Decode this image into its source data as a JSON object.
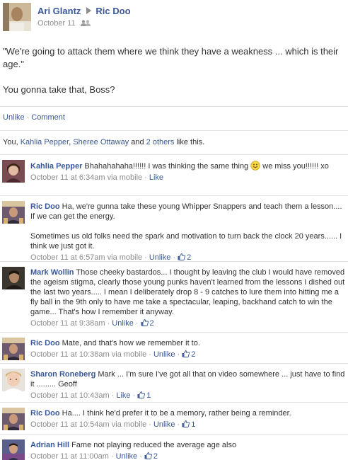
{
  "post": {
    "author": "Ari Glantz",
    "target": "Ric Doo",
    "date": "October 11",
    "text_line1": "\"We're going to attack them where we think they have a weakness ... which is their age.\"",
    "text_line2": "You gonna take that, Boss?",
    "action_unlike": "Unlike",
    "action_comment": "Comment",
    "likes_prefix": "You, ",
    "liker1": "Kahlia Pepper",
    "likes_sep": ", ",
    "liker2": "Sheree Ottaway",
    "likes_and": " and ",
    "likes_others": "2 others",
    "likes_suffix": " like this."
  },
  "comments": [
    {
      "author": "Kahlia Pepper",
      "text": " Bhahahahaha!!!!!! I was thinking the same thing ",
      "text_after_emoji": " we miss you!!!!!! xo",
      "time": "October 11 at 6:34am via mobile",
      "action": "Like",
      "likes": ""
    },
    {
      "author": "Ric Doo",
      "text": " Ha, we're gunna take these young Whipper Snappers and teach them a lesson.... If we can get the energy.",
      "text2": "Sometimes us old folks need the spark and motivation to turn back the clock 20 years...... I think we just got it.",
      "time": "October 11 at 6:57am via mobile",
      "action": "Unlike",
      "likes": "2"
    },
    {
      "author": "Mark Wollin",
      "text": " Those cheeky bastardos... I thought by leaving the club I would have removed the ageism stigma, clearly those young punks haven't learned from the lessons I dished out the last two years..... I mean I deliberately drop 8 - 9 catches to lure them into hitting me a fly ball in the 9th only to have me take a spectacular, leaping, backhand catch to win the game... That's how I remember it anyway.",
      "time": "October 11 at 9:38am",
      "action": "Unlike",
      "likes": "2"
    },
    {
      "author": "Ric Doo",
      "text": " Mate, and that's how we remember it to.",
      "time": "October 11 at 10:38am via mobile",
      "action": "Unlike",
      "likes": "2"
    },
    {
      "author": "Sharon Roneberg",
      "text": " Mark ... I'm sure I've got all that on video somewhere ... just have to find it ......... Geoff",
      "time": "October 11 at 10:43am",
      "action": "Like",
      "likes": "1"
    },
    {
      "author": "Ric Doo",
      "text": " Ha.... I think he'd prefer it to be a memory, rather being a reminder.",
      "time": "October 11 at 10:54am via mobile",
      "action": "Unlike",
      "likes": "1"
    },
    {
      "author": "Adrian Hill",
      "text": " Fame not playing reduced the average age also",
      "time": "October 11 at 11:00am",
      "action": "Unlike",
      "likes": "2"
    }
  ],
  "colors": {
    "link": "#3b5998",
    "meta": "#8c8c8c",
    "divider": "#e5e5e5"
  }
}
